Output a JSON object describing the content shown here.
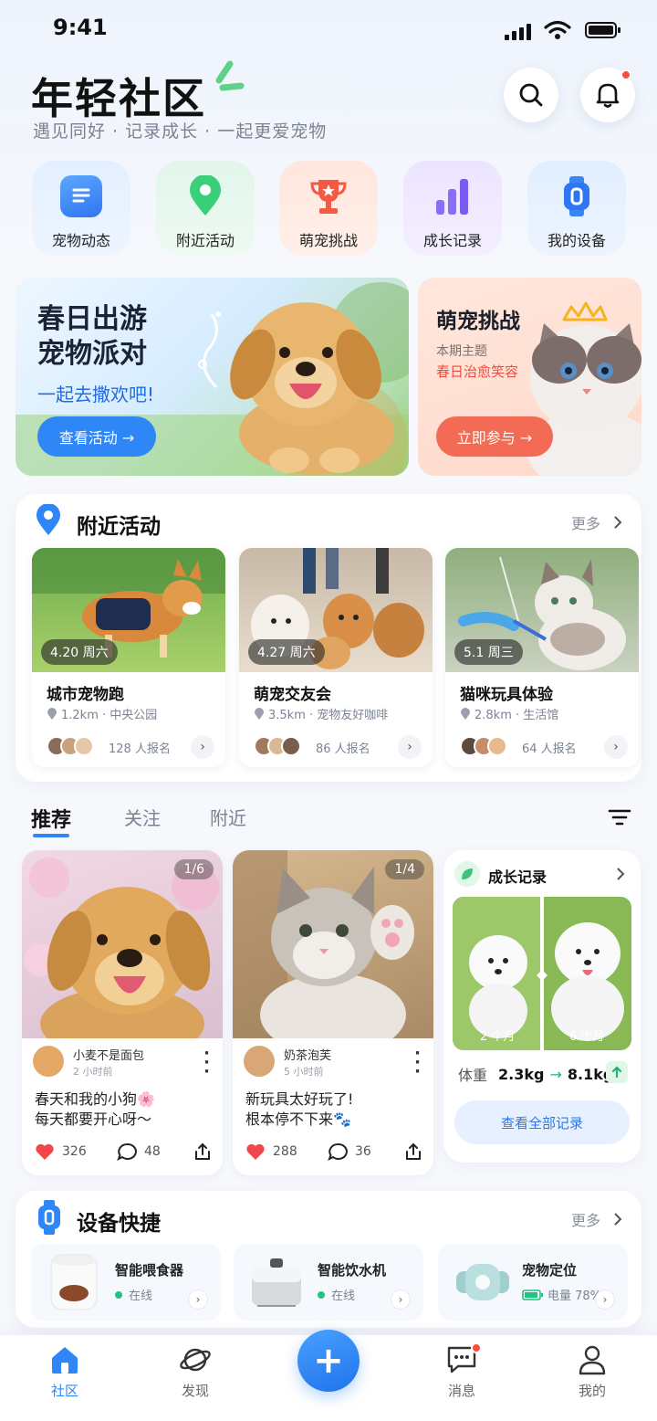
{
  "status": {
    "time": "9:41"
  },
  "header": {
    "title": "年轻社区",
    "subtitle": "遇见同好 · 记录成长 · 一起更爱宠物"
  },
  "quick_entries": [
    {
      "label": "宠物动态",
      "icon": "document-icon"
    },
    {
      "label": "附近活动",
      "icon": "location-pin-icon"
    },
    {
      "label": "萌宠挑战",
      "icon": "trophy-icon"
    },
    {
      "label": "成长记录",
      "icon": "bar-chart-icon"
    },
    {
      "label": "我的设备",
      "icon": "smartwatch-icon"
    }
  ],
  "banner_main": {
    "line1": "春日出游",
    "line2": "宠物派对",
    "tagline": "一起去撒欢吧!",
    "button": "查看活动 →"
  },
  "banner_side": {
    "title": "萌宠挑战",
    "theme_label": "本期主题",
    "theme": "春日治愈笑容",
    "button": "立即参与 →"
  },
  "nearby": {
    "title": "附近活动",
    "more": "更多",
    "items": [
      {
        "date": "4.20",
        "weekday": "周六",
        "name": "城市宠物跑",
        "location": "1.2km · 中央公园",
        "count": "128 人报名"
      },
      {
        "date": "4.27",
        "weekday": "周六",
        "name": "萌宠交友会",
        "location": "3.5km · 宠物友好咖啡",
        "count": "86 人报名"
      },
      {
        "date": "5.1",
        "weekday": "周三",
        "name": "猫咪玩具体验",
        "location": "2.8km · 生活馆",
        "count": "64 人报名"
      }
    ]
  },
  "feed_tabs": [
    "推荐",
    "关注",
    "附近"
  ],
  "posts": [
    {
      "page": "1/6",
      "user": "小麦不是面包",
      "time": "2 小时前",
      "line1": "春天和我的小狗🌸",
      "line2": "每天都要开心呀～",
      "likes": "326",
      "comments": "48"
    },
    {
      "page": "1/4",
      "user": "奶茶泡芙",
      "time": "5 小时前",
      "line1": "新玩具太好玩了!",
      "line2": "根本停不下来🐾",
      "likes": "288",
      "comments": "36"
    }
  ],
  "growth": {
    "title": "成长记录",
    "before": "2 个月",
    "after": "6 个月",
    "weight_label": "体重",
    "weight_from": "2.3kg",
    "weight_to": "8.1kg",
    "button": "查看全部记录"
  },
  "devices": {
    "title": "设备快捷",
    "more": "更多",
    "items": [
      {
        "name": "智能喂食器",
        "status": "在线"
      },
      {
        "name": "智能饮水机",
        "status": "在线"
      },
      {
        "name": "宠物定位",
        "status": "电量 78%"
      }
    ]
  },
  "bottom_nav": [
    {
      "label": "社区",
      "active": true
    },
    {
      "label": "发现"
    },
    {
      "label": "+"
    },
    {
      "label": "消息"
    },
    {
      "label": "我的"
    }
  ],
  "colors": {
    "accent": "#2f86f6",
    "like": "#f2474a",
    "online": "#22c37d",
    "challenge": "#f36a55"
  }
}
